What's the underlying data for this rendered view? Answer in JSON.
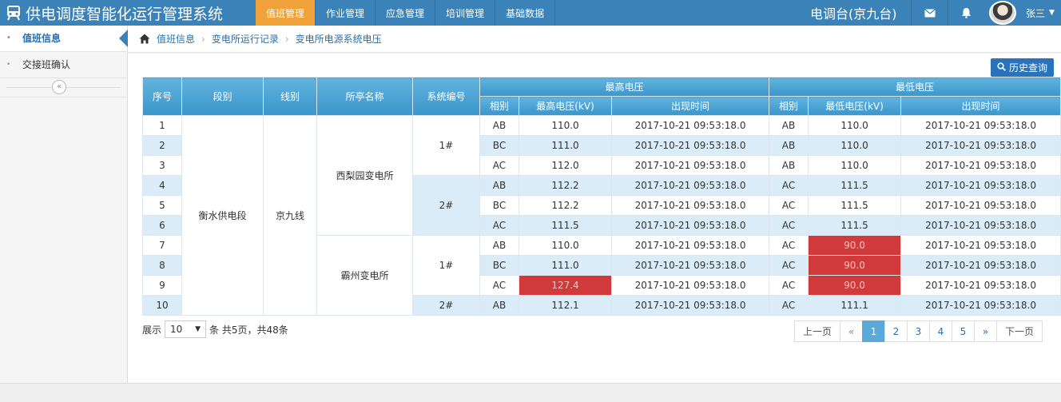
{
  "header": {
    "title": "供电调度智能化运行管理系统",
    "nav": [
      "值班管理",
      "作业管理",
      "应急管理",
      "培训管理",
      "基础数据"
    ],
    "active_nav": 0,
    "station": "电调台(京九台)",
    "user_name": "张三",
    "colors": {
      "bar": "#3a82b8",
      "active_tab": "#f0a13a"
    }
  },
  "sidebar": {
    "items": [
      {
        "label": "值班信息",
        "active": true
      },
      {
        "label": "交接班确认",
        "active": false
      }
    ],
    "collapse_glyph": "«"
  },
  "breadcrumb": [
    "值班信息",
    "变电所运行记录",
    "变电所电源系统电压"
  ],
  "main": {
    "history_button": "历史查询",
    "table": {
      "headers": {
        "seq": "序号",
        "section": "段别",
        "line": "线别",
        "station": "所亭名称",
        "system": "系统编号",
        "max_group": "最高电压",
        "min_group": "最低电压",
        "phase": "相别",
        "max_v": "最高电压(kV)",
        "min_v": "最低电压(kV)",
        "time": "出现时间"
      },
      "section": "衡水供电段",
      "line": "京九线",
      "stations": [
        "西梨园变电所",
        "霸州变电所"
      ],
      "systems": [
        "1#",
        "2#",
        "1#",
        "2#"
      ],
      "rows": [
        {
          "seq": "1",
          "phase_max": "AB",
          "max_v": "110.0",
          "max_time": "2017-10-21 09:53:18.0",
          "phase_min": "AB",
          "min_v": "110.0",
          "min_time": "2017-10-21 09:53:18.0"
        },
        {
          "seq": "2",
          "phase_max": "BC",
          "max_v": "111.0",
          "max_time": "2017-10-21 09:53:18.0",
          "phase_min": "AB",
          "min_v": "110.0",
          "min_time": "2017-10-21 09:53:18.0"
        },
        {
          "seq": "3",
          "phase_max": "AC",
          "max_v": "112.0",
          "max_time": "2017-10-21 09:53:18.0",
          "phase_min": "AB",
          "min_v": "110.0",
          "min_time": "2017-10-21 09:53:18.0"
        },
        {
          "seq": "4",
          "phase_max": "AB",
          "max_v": "112.2",
          "max_time": "2017-10-21 09:53:18.0",
          "phase_min": "AC",
          "min_v": "111.5",
          "min_time": "2017-10-21 09:53:18.0"
        },
        {
          "seq": "5",
          "phase_max": "BC",
          "max_v": "112.2",
          "max_time": "2017-10-21 09:53:18.0",
          "phase_min": "AC",
          "min_v": "111.5",
          "min_time": "2017-10-21 09:53:18.0"
        },
        {
          "seq": "6",
          "phase_max": "AC",
          "max_v": "111.5",
          "max_time": "2017-10-21 09:53:18.0",
          "phase_min": "AC",
          "min_v": "111.5",
          "min_time": "2017-10-21 09:53:18.0"
        },
        {
          "seq": "7",
          "phase_max": "AB",
          "max_v": "110.0",
          "max_time": "2017-10-21 09:53:18.0",
          "phase_min": "AC",
          "min_v": "90.0",
          "min_time": "2017-10-21 09:53:18.0",
          "min_alarm": true
        },
        {
          "seq": "8",
          "phase_max": "BC",
          "max_v": "111.0",
          "max_time": "2017-10-21 09:53:18.0",
          "phase_min": "AC",
          "min_v": "90.0",
          "min_time": "2017-10-21 09:53:18.0",
          "min_alarm": true
        },
        {
          "seq": "9",
          "phase_max": "AC",
          "max_v": "127.4",
          "max_time": "2017-10-21 09:53:18.0",
          "phase_min": "AC",
          "min_v": "90.0",
          "min_time": "2017-10-21 09:53:18.0",
          "max_alarm": true,
          "min_alarm": true
        },
        {
          "seq": "10",
          "phase_max": "AB",
          "max_v": "112.1",
          "max_time": "2017-10-21 09:53:18.0",
          "phase_min": "AC",
          "min_v": "111.1",
          "min_time": "2017-10-21 09:53:18.0"
        }
      ],
      "alarm_color": "#d13a3a"
    },
    "pager": {
      "show_label": "展示",
      "page_size": "10",
      "summary": "条 共5页，共48条",
      "prev": "上一页",
      "first": "«",
      "pages": [
        "1",
        "2",
        "3",
        "4",
        "5"
      ],
      "current": "1",
      "last": "»",
      "next": "下一页"
    }
  }
}
